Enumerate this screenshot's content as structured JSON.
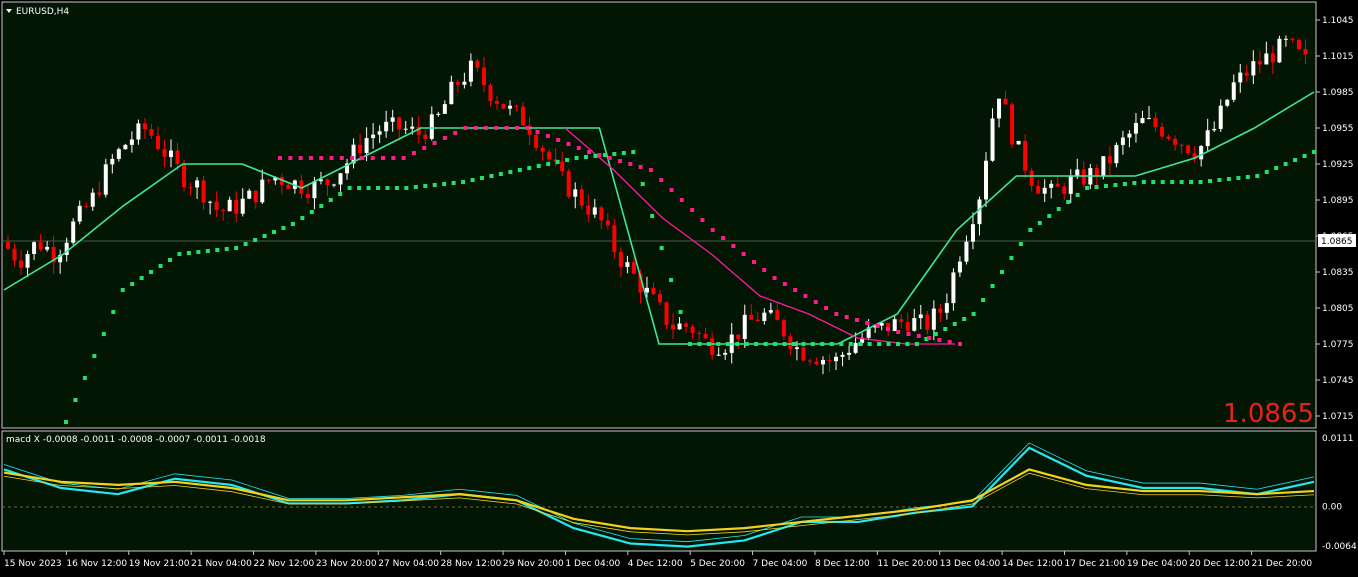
{
  "window": {
    "symbol_title": "EURUSD,H4",
    "dropdown_icon": "triangle-down-icon"
  },
  "colors": {
    "background": "#000000",
    "chart_bg": "#031503",
    "frame": "#c8c8c8",
    "bull_candle": "#ffffff",
    "bear_candle": "#ff0000",
    "green_channel": "#3ce89a",
    "green_dots": "#22e06a",
    "pink_channel": "#ff1aa0",
    "pink_dots": "#ff1a8c",
    "macd_cyan": "#22e7f5",
    "macd_yellow": "#f5d21a",
    "big_price": "#e8231a",
    "text": "#ffffff"
  },
  "main": {
    "price_axis": [
      "1.1045",
      "1.1015",
      "1.0985",
      "1.0955",
      "1.0925",
      "1.0895",
      "1.0865",
      "1.0835",
      "1.0805",
      "1.0775",
      "1.0745",
      "1.0715"
    ],
    "current_price_label": "1.0865",
    "big_price": "1.0865"
  },
  "macd": {
    "label": "macd X -0.0008 -0.0011 -0.0008 -0.0007 -0.0011 -0.0018",
    "axis": [
      "0.0111",
      "0.00",
      "-0.0064"
    ]
  },
  "time_axis": [
    "15 Nov 2023",
    "16 Nov 12:00",
    "19 Nov 21:00",
    "21 Nov 04:00",
    "22 Nov 12:00",
    "23 Nov 20:00",
    "27 Nov 04:00",
    "28 Nov 12:00",
    "29 Nov 20:00",
    "1 Dec 04:00",
    "4 Dec 12:00",
    "5 Dec 20:00",
    "7 Dec 04:00",
    "8 Dec 12:00",
    "11 Dec 20:00",
    "13 Dec 04:00",
    "14 Dec 12:00",
    "17 Dec 21:00",
    "19 Dec 04:00",
    "20 Dec 12:00",
    "21 Dec 20:00"
  ],
  "chart_data": {
    "type": "candlestick",
    "symbol": "EURUSD",
    "timeframe": "H4",
    "ylim": [
      1.0705,
      1.1055
    ],
    "path": [
      1.086,
      1.0845,
      1.086,
      1.085,
      1.0875,
      1.0895,
      1.0925,
      1.0945,
      1.0955,
      1.0935,
      1.0915,
      1.0905,
      1.0885,
      1.089,
      1.09,
      1.0915,
      1.091,
      1.0905,
      1.091,
      1.0925,
      1.0945,
      1.0955,
      1.0955,
      1.095,
      1.096,
      1.099,
      1.1005,
      1.0985,
      1.097,
      1.096,
      1.0935,
      1.091,
      1.0895,
      1.088,
      1.085,
      1.083,
      1.081,
      1.079,
      1.079,
      1.0775,
      1.0775,
      1.079,
      1.08,
      1.079,
      1.077,
      1.0765,
      1.076,
      1.0775,
      1.0785,
      1.079,
      1.0795,
      1.079,
      1.0805,
      1.0855,
      1.09,
      1.099,
      1.094,
      1.091,
      1.09,
      1.091,
      1.0915,
      1.0925,
      1.0945,
      1.096,
      1.0955,
      1.0945,
      1.0935,
      1.0955,
      1.099,
      1.1005,
      1.1015,
      1.1025,
      1.101
    ],
    "green_channel": [
      1.082,
      1.085,
      1.089,
      1.0925,
      1.0925,
      1.0905,
      1.093,
      1.0955,
      1.0955,
      1.0955,
      1.0955,
      1.0775,
      1.0775,
      1.0775,
      1.0775,
      1.08,
      1.087,
      1.0915,
      1.0915,
      1.0915,
      1.093,
      1.0955,
      1.0985
    ],
    "green_dots": [
      1.071,
      1.082,
      1.085,
      1.0855,
      1.0875,
      1.0905,
      1.0905,
      1.091,
      1.092,
      1.093,
      1.0935,
      1.0775,
      1.0775,
      1.0775,
      1.0775,
      1.0775,
      1.08,
      1.087,
      1.0905,
      1.091,
      1.091,
      1.0915,
      1.0935
    ],
    "pink_channel": [
      1.0955,
      1.092,
      1.088,
      1.085,
      1.0815,
      1.08,
      1.078,
      1.0775,
      1.0775
    ],
    "pink_dots": [
      1.093,
      1.093,
      1.093,
      1.0955,
      1.0955,
      1.0935,
      1.092,
      1.087,
      1.083,
      1.08,
      1.0785,
      1.0775
    ],
    "macd_cyan": [
      0.006,
      0.003,
      0.002,
      0.0045,
      0.0035,
      0.0005,
      0.0005,
      0.001,
      0.002,
      0.001,
      -0.0035,
      -0.006,
      -0.0065,
      -0.0055,
      -0.0025,
      -0.0025,
      -0.001,
      0.0,
      0.0095,
      0.005,
      0.003,
      0.003,
      0.002,
      0.004
    ],
    "macd_yellow": [
      0.0055,
      0.004,
      0.0035,
      0.004,
      0.003,
      0.001,
      0.001,
      0.0015,
      0.002,
      0.001,
      -0.002,
      -0.0035,
      -0.004,
      -0.0035,
      -0.0025,
      -0.0015,
      -0.0005,
      0.001,
      0.006,
      0.0035,
      0.0025,
      0.0025,
      0.002,
      0.0025
    ],
    "macd_ylim": [
      -0.0064,
      0.0111
    ]
  }
}
